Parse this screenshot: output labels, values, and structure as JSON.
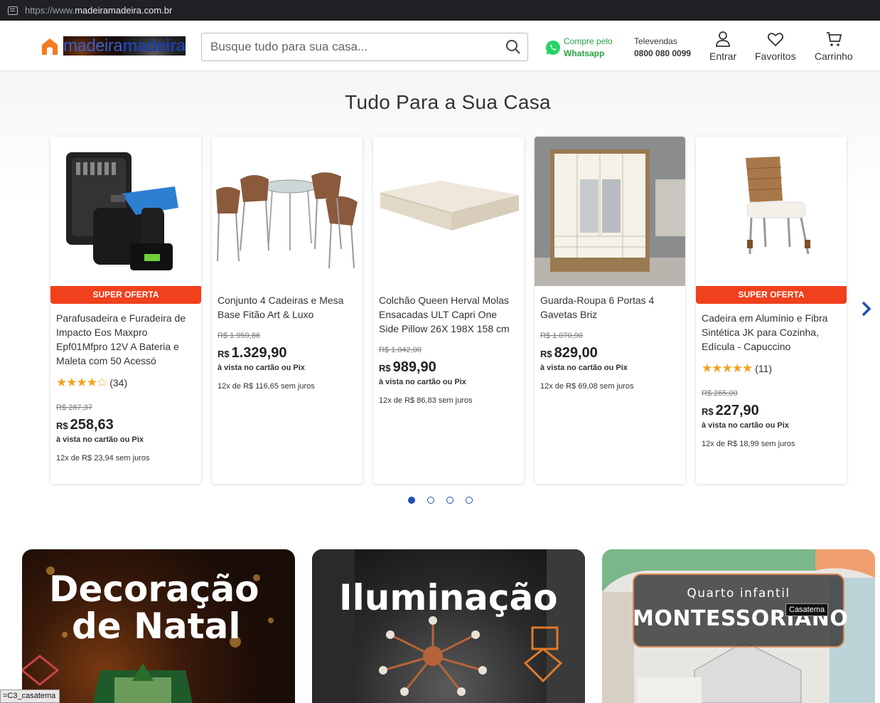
{
  "browser": {
    "url_prefix": "https://www.",
    "url_domain": "madeiramadeira.com.br"
  },
  "header": {
    "brand_part1": "madeira",
    "brand_part2": "madeira",
    "search_placeholder": "Busque tudo para sua casa...",
    "whatsapp_line1": "Compre pelo",
    "whatsapp_line2": "Whatsapp",
    "tele_label": "Televendas",
    "tele_number": "0800 080 0099",
    "login_label": "Entrar",
    "favorites_label": "Favoritos",
    "cart_label": "Carrinho"
  },
  "section": {
    "title": "Tudo Para a Sua Casa"
  },
  "products": [
    {
      "badge": "SUPER OFERTA",
      "name": "Parafusadeira e Furadeira de Impacto Eos Maxpro Epf01Mfpro 12V A Bateria e Maleta com 50 Acessó",
      "stars": "★★★★☆",
      "rating_count": "(34)",
      "old_price": "R$ 287,37",
      "currency": "R$",
      "price": "258,63",
      "pix": "à vista no cartão ou Pix",
      "installments": "12x de R$ 23,94 sem juros"
    },
    {
      "badge": "",
      "name": "Conjunto 4 Cadeiras e Mesa Base Fitão Art & Luxo",
      "old_price": "R$ 1.959,86",
      "currency": "R$",
      "price": "1.329,90",
      "pix": "à vista no cartão ou Pix",
      "installments": "12x de R$ 116,65 sem juros"
    },
    {
      "badge": "",
      "name": "Colchão Queen Herval Molas Ensacadas ULT Capri One Side Pillow 26X 198X 158 cm",
      "old_price": "R$ 1.042,00",
      "currency": "R$",
      "price": "989,90",
      "pix": "à vista no cartão ou Pix",
      "installments": "12x de R$ 86,83 sem juros"
    },
    {
      "badge": "",
      "name": "Guarda-Roupa 6 Portas 4 Gavetas Briz",
      "old_price": "R$ 1.070,90",
      "currency": "R$",
      "price": "829,00",
      "pix": "à vista no cartão ou Pix",
      "installments": "12x de R$ 69,08 sem juros"
    },
    {
      "badge": "SUPER OFERTA",
      "name": "Cadeira em Alumínio e Fibra Sintética JK para Cozinha, Edícula - Capuccino",
      "stars": "★★★★★",
      "rating_count": "(11)",
      "old_price": "R$ 265,00",
      "currency": "R$",
      "price": "227,90",
      "pix": "à vista no cartão ou Pix",
      "installments": "12x de R$ 18,99 sem juros"
    }
  ],
  "banners": {
    "natal_line1": "Decoração",
    "natal_line2": "de Natal",
    "iluminacao": "Iluminação",
    "quarto_line1": "Quarto infantil",
    "quarto_line2": "MONTESSORIANO"
  },
  "tooltip": "Casatema",
  "status": "=C3_casatema",
  "colors": {
    "brand_blue": "#1d3fa5",
    "offer_red": "#f0401c",
    "whatsapp_green": "#25a244",
    "star": "#f4a21c"
  }
}
